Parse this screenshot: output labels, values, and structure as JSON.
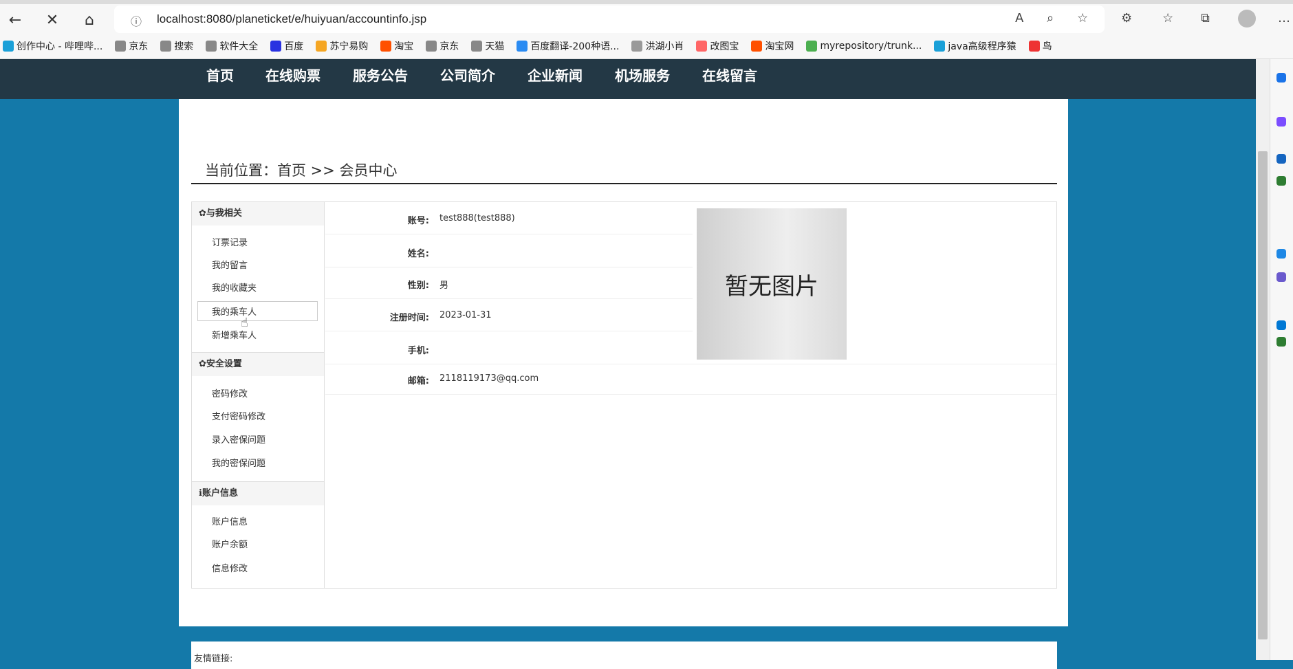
{
  "browser": {
    "url": "localhost:8080/planeticket/e/huiyuan/accountinfo.jsp",
    "bookmarks": [
      "创作中心 - 哔哩哔...",
      "京东",
      "搜索",
      "软件大全",
      "百度",
      "苏宁易购",
      "淘宝",
      "京东",
      "天猫",
      "百度翻译-200种语...",
      "洪湖小肖",
      "改图宝",
      "淘宝网",
      "myrepository/trunk...",
      "java高级程序猿",
      "鸟"
    ],
    "bookmark_colors": [
      "#1aa0d8",
      "#888",
      "#888",
      "#888",
      "#2932e1",
      "#f5a623",
      "#ff5000",
      "#888",
      "#888",
      "#2a8bf2",
      "#999",
      "#f66",
      "#ff5000",
      "#4caf50",
      "#1aa0d8",
      "#e33"
    ]
  },
  "nav": [
    "首页",
    "在线购票",
    "服务公告",
    "公司简介",
    "企业新闻",
    "机场服务",
    "在线留言"
  ],
  "breadcrumb": "当前位置：首页 >> 会员中心",
  "sidebar": [
    {
      "header": "✿与我相关",
      "items": [
        "订票记录",
        "我的留言",
        "我的收藏夹",
        "我的乘车人",
        "新增乘车人"
      ]
    },
    {
      "header": "✿安全设置",
      "items": [
        "密码修改",
        "支付密码修改",
        "录入密保问题",
        "我的密保问题"
      ]
    },
    {
      "header": "ℹ账户信息",
      "items": [
        "账户信息",
        "账户余额",
        "信息修改"
      ]
    }
  ],
  "info": [
    {
      "label": "账号:",
      "value": "test888(test888)"
    },
    {
      "label": "姓名:",
      "value": ""
    },
    {
      "label": "性别:",
      "value": "男"
    },
    {
      "label": "注册时间:",
      "value": "2023-01-31"
    },
    {
      "label": "手机:",
      "value": ""
    },
    {
      "label": "邮箱:",
      "value": "2118119173@qq.com"
    }
  ],
  "photo_placeholder": "暂无图片",
  "footer": "友情链接:"
}
